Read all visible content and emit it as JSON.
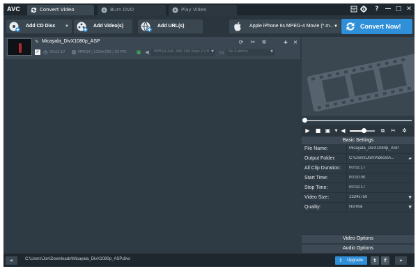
{
  "app": {
    "logo": "AVC",
    "tabs": [
      {
        "label": "Convert Video",
        "active": true,
        "icon": "convert-icon"
      },
      {
        "label": "Burn DVD",
        "active": false,
        "icon": "disc-icon"
      },
      {
        "label": "Play Video",
        "active": false,
        "icon": "play-icon"
      }
    ],
    "window_controls": [
      "skin-icon",
      "gear-icon",
      "help-icon",
      "minimize-icon",
      "maximize-icon",
      "close-icon"
    ],
    "window_control_glyphs": {
      "help": "?",
      "minimize": "—",
      "maximize": "□",
      "close": "✕"
    }
  },
  "toolbar": {
    "add_cd": "Add CD Disc",
    "add_video": "Add Video(s)",
    "add_url": "Add URL(s)",
    "profile": "Apple iPhone 6s MPEG-4 Movie (*.m...",
    "convert": "Convert Now!"
  },
  "file": {
    "name": "Micayala_DivX1080p_ASP",
    "checked": true,
    "check_glyph": "✓",
    "duration": "00:02:17",
    "video_info": "MPEG4 | 1334x750 | 33 FPS",
    "audio_track": "MPEG4 AAC 44K 160 Kbps 2 CH",
    "subtitle": "No Subtitle"
  },
  "player": {
    "position": 0.0,
    "volume": 0.55
  },
  "settings": {
    "header": "Basic Settings",
    "rows": [
      {
        "key": "File Name:",
        "value": "Micayala_DivX1080p_ASP"
      },
      {
        "key": "Output Folder:",
        "value": "C:\\Users\\Jon\\Videos\\A..."
      },
      {
        "key": "All Clip Duration:",
        "value": "00:02:17"
      },
      {
        "key": "Start Time:",
        "value": "00:00:00"
      },
      {
        "key": "Stop Time:",
        "value": "00:02:17"
      },
      {
        "key": "Video Size:",
        "value": "1334x750"
      },
      {
        "key": "Quality:",
        "value": "Normal"
      }
    ],
    "video_options": "Video Options",
    "audio_options": "Audio Options"
  },
  "status": {
    "path": "C:\\Users\\Jon\\Downloads\\Micayala_DivX1080p_ASP.divx",
    "upgrade": "Upgrade",
    "nav_left": "«",
    "nav_right": "»",
    "social": [
      "t",
      "f"
    ]
  },
  "colors": {
    "accent": "#2f8fd8",
    "background": "#2e3a44",
    "titlebar": "#1e272e"
  }
}
